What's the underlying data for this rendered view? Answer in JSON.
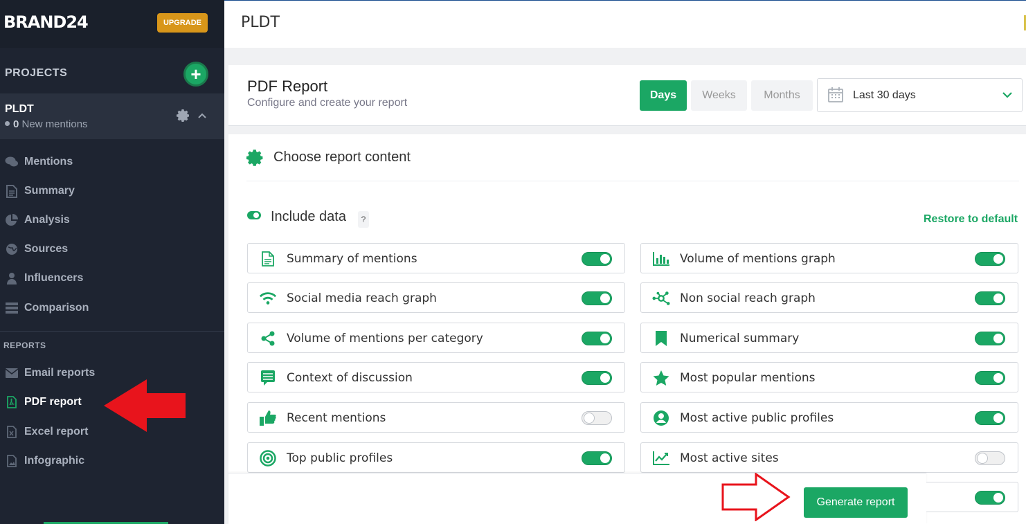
{
  "brand": {
    "logo": "BRAND24",
    "upgrade": "UPGRADE"
  },
  "projects": {
    "header": "PROJECTS",
    "add_symbol": "+",
    "current": {
      "name": "PLDT",
      "count": "0",
      "mentions_label": "New mentions"
    }
  },
  "nav": [
    {
      "label": "Mentions",
      "icon": "comments-icon"
    },
    {
      "label": "Summary",
      "icon": "document-icon"
    },
    {
      "label": "Analysis",
      "icon": "pie-chart-icon"
    },
    {
      "label": "Sources",
      "icon": "globe-icon"
    },
    {
      "label": "Influencers",
      "icon": "user-icon"
    },
    {
      "label": "Comparison",
      "icon": "server-icon"
    }
  ],
  "reports": {
    "header": "REPORTS",
    "items": [
      {
        "label": "Email reports",
        "icon": "envelope-icon"
      },
      {
        "label": "PDF report",
        "icon": "pdf-file-icon",
        "active": true
      },
      {
        "label": "Excel report",
        "icon": "excel-file-icon"
      },
      {
        "label": "Infographic",
        "icon": "image-file-icon"
      }
    ]
  },
  "topbar": {
    "title": "PLDT"
  },
  "report_header": {
    "title": "PDF Report",
    "subtitle": "Configure and create your report",
    "periods": [
      "Days",
      "Weeks",
      "Months"
    ],
    "selected_period": "Days",
    "date_range": "Last 30 days"
  },
  "content": {
    "title": "Choose report content",
    "include_data": "Include data",
    "help": "?",
    "restore": "Restore to default",
    "options_left": [
      {
        "label": "Summary of mentions",
        "icon": "document-icon",
        "on": true
      },
      {
        "label": "Social media reach graph",
        "icon": "wifi-icon",
        "on": true
      },
      {
        "label": "Volume of mentions per category",
        "icon": "share-icon",
        "on": true
      },
      {
        "label": "Context of discussion",
        "icon": "chat-lines-icon",
        "on": true
      },
      {
        "label": "Recent mentions",
        "icon": "thumbs-up-icon",
        "on": false
      },
      {
        "label": "Top public profiles",
        "icon": "target-icon",
        "on": true
      }
    ],
    "options_right": [
      {
        "label": "Volume of mentions graph",
        "icon": "bar-chart-icon",
        "on": true
      },
      {
        "label": "Non social reach graph",
        "icon": "network-icon",
        "on": true
      },
      {
        "label": "Numerical summary",
        "icon": "bookmark-icon",
        "on": true
      },
      {
        "label": "Most popular mentions",
        "icon": "star-icon",
        "on": true
      },
      {
        "label": "Most active public profiles",
        "icon": "user-circle-icon",
        "on": true
      },
      {
        "label": "Most active sites",
        "icon": "line-chart-icon",
        "on": false
      }
    ],
    "extra_option_on": true,
    "generate": "Generate report"
  },
  "colors": {
    "accent": "#1ba764",
    "sidebar": "#1e2431",
    "upgrade": "#d8961a",
    "annotation_red": "#e8141c"
  }
}
